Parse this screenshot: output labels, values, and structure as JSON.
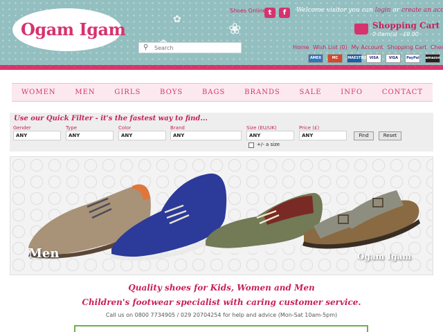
{
  "header": {
    "logo_text": "Ogam Igam",
    "shoes_online": "Shoes Online",
    "welcome_prefix": "Welcome visitor you can",
    "login_label": "login",
    "or_label": "or",
    "create_account_label": "create an account",
    "cart_title": "Shopping Cart",
    "cart_summary": "0 item(s) - £0.00",
    "search_placeholder": "Search",
    "account_links": [
      "Home",
      "Wish List (0)",
      "My Account",
      "Shopping Cart",
      "Checkout"
    ],
    "payment_cards": [
      "AMEX",
      "MC",
      "MAESTRO",
      "VISA",
      "VISA",
      "PayPal",
      "amazon"
    ]
  },
  "nav": {
    "items": [
      "WOMEN",
      "MEN",
      "GIRLS",
      "BOYS",
      "BAGS",
      "BRANDS",
      "SALE",
      "INFO",
      "CONTACT"
    ]
  },
  "filter": {
    "title": "Use our Quick Filter - it's the fastest way to find...",
    "fields": [
      {
        "label": "Gender",
        "value": "ANY"
      },
      {
        "label": "Type",
        "value": "ANY"
      },
      {
        "label": "Color",
        "value": "ANY"
      },
      {
        "label": "Brand",
        "value": "ANY"
      },
      {
        "label": "Size (EU/UK)",
        "value": "ANY"
      },
      {
        "label": "Price (£)",
        "value": "ANY"
      }
    ],
    "find_label": "Find",
    "reset_label": "Reset",
    "size_toggle_label": "+/- a size"
  },
  "banner": {
    "label": "Men",
    "logo_text": "Ogam Igam"
  },
  "content": {
    "tagline1": "Quality shoes for Kids, Women and Men",
    "tagline2": "Children's footwear specialist with caring customer service.",
    "call": "Call us on 0800 7734905 / 029 20704254 for help and advice (Mon-Sat 10am-5pm)"
  },
  "colors": {
    "brand_pink": "#d6336e",
    "header_teal": "#93bfc0",
    "nav_bg": "#fbe9ef"
  }
}
